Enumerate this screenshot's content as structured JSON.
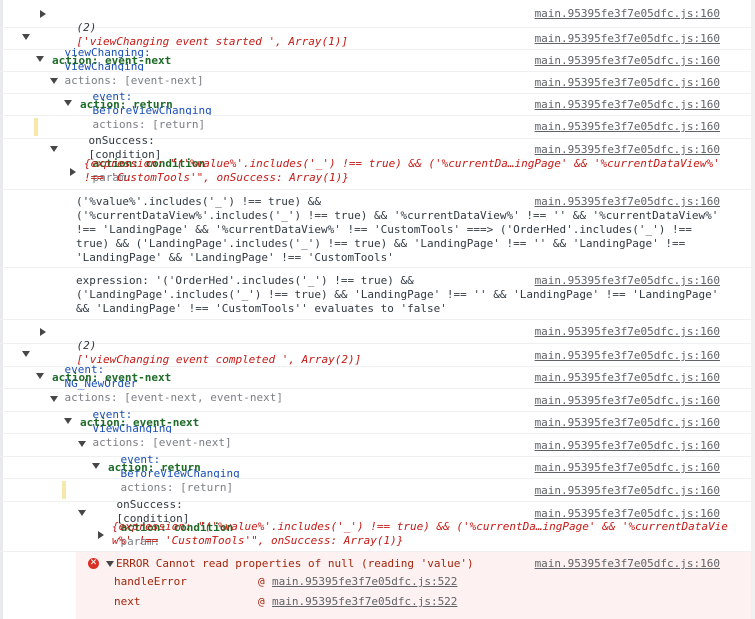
{
  "src_main": "main.95395fe3f7e05dfc.js:160",
  "src_err": "main.95395fe3f7e05dfc.js:522",
  "r1": {
    "count": "(2)",
    "body": "['viewChanging event started ', Array(1)]"
  },
  "r2": {
    "label": "viewChanging:",
    "type": "ViewChanging",
    "actions": "actions: [event-next]"
  },
  "r3": {
    "label": "action: event-next"
  },
  "r4": {
    "label": "event:",
    "type": "BeforeViewChanging",
    "actions": "actions: [return]"
  },
  "r5": {
    "label": "action: return"
  },
  "r6": {
    "label": "onSuccess:",
    "value": "[condition]"
  },
  "r7": {
    "label": "action: condition",
    "param": "param:"
  },
  "r7b": {
    "l1": "{expression: \"('%value%'.includes('_') !== true) && ('%currentDa…ingPage' && '%currentDataView%'",
    "l2": "!== 'CustomTools'\", onSuccess: Array(1)}"
  },
  "r8": {
    "l1": "('%value%'.includes('_') !== true) &&",
    "l2": "('%currentDataView%'.includes('_') !== true) && '%currentDataView%' !== '' && '%currentDataView%'",
    "l3": "!== 'LandingPage' && '%currentDataView%' !== 'CustomTools' ===> ('OrderHed'.includes('_') !==",
    "l4": "true) && ('LandingPage'.includes('_') !== true) && 'LandingPage' !== '' && 'LandingPage' !==",
    "l5": "'LandingPage' && 'LandingPage' !== 'CustomTools'"
  },
  "r9": {
    "l1": "expression: '('OrderHed'.includes('_') !== true) &&",
    "l2": "('LandingPage'.includes('_') !== true) && 'LandingPage' !== '' && 'LandingPage' !== 'LandingPage'",
    "l3": "&& 'LandingPage' !== 'CustomTools'' evaluates to 'false'"
  },
  "r10": {
    "count": "(2)",
    "body": "['viewChanging event completed ', Array(2)]"
  },
  "r11": {
    "label": "event:",
    "type": "NG_NewOrder",
    "actions": "actions: [event-next, event-next]"
  },
  "r12": {
    "label": "action: event-next"
  },
  "r13": {
    "label": "event:",
    "type": "ViewChanging",
    "actions": "actions: [event-next]"
  },
  "r14": {
    "label": "action: event-next"
  },
  "r15": {
    "label": "event:",
    "type": "BeforeViewChanging",
    "actions": "actions: [return]"
  },
  "r16": {
    "label": "action: return"
  },
  "r17": {
    "label": "onSuccess:",
    "value": "[condition]"
  },
  "r18": {
    "label": "action: condition",
    "param": "param:"
  },
  "r18b": {
    "l1": "{expression: \"('%value%'.includes('_') !== true) && ('%currentDa…ingPage' && '%currentDataVie",
    "l2": "w%' !== 'CustomTools'\", onSuccess: Array(1)}"
  },
  "err": {
    "title": "ERROR Cannot read properties of null (reading 'value')",
    "f1": "handleError",
    "f2": "next",
    "at": "@"
  }
}
